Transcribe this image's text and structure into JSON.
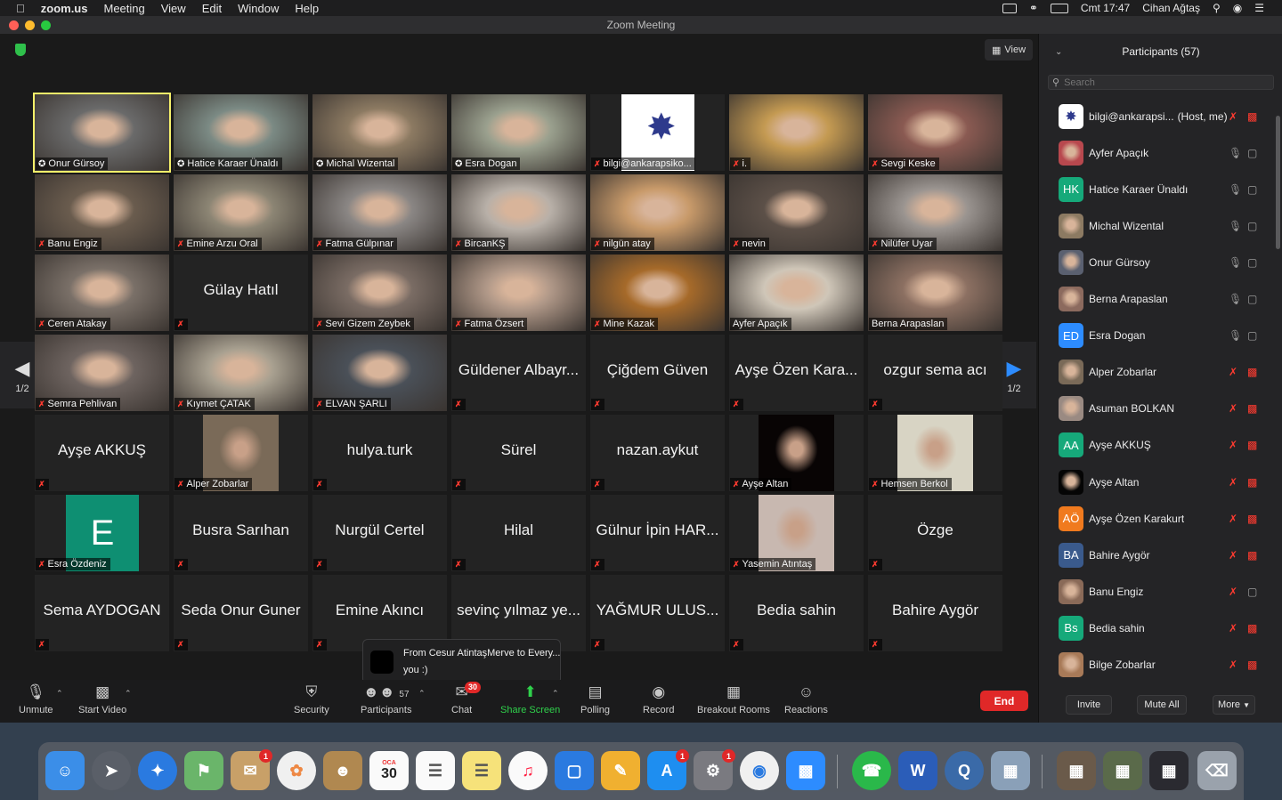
{
  "menubar": {
    "app": "zoom.us",
    "menus": [
      "Meeting",
      "View",
      "Edit",
      "Window",
      "Help"
    ],
    "clock": "Cmt 17:47",
    "user": "Cihan Ağtaş"
  },
  "window": {
    "title": "Zoom Meeting",
    "view_label": "View"
  },
  "pager": {
    "left": "1/2",
    "right": "1/2"
  },
  "tiles": [
    {
      "name": "Onur Gürsoy",
      "type": "video",
      "bg": "#6a6a6a",
      "host": true,
      "active": true
    },
    {
      "name": "Hatice Karaer Ünaldı",
      "type": "video",
      "bg": "#7b8a84",
      "host": true
    },
    {
      "name": "Michal Wizental",
      "type": "video",
      "bg": "#8c7a62",
      "host": true
    },
    {
      "name": "Esra Dogan",
      "type": "video",
      "bg": "#9aa08e",
      "host": true
    },
    {
      "name": "bilgi@ankarapsiko...",
      "type": "logo",
      "bg": "#ffffff",
      "muted": true
    },
    {
      "name": "i.",
      "type": "video",
      "bg": "#c49a52",
      "muted": true
    },
    {
      "name": "Sevgi Keske",
      "type": "video",
      "bg": "#8a5a52",
      "muted": true
    },
    {
      "name": "Banu Engiz",
      "type": "video",
      "bg": "#6a5c4e",
      "muted": true
    },
    {
      "name": "Emine Arzu Oral",
      "type": "video",
      "bg": "#8c8574",
      "muted": true
    },
    {
      "name": "Fatma Gülpınar",
      "type": "video",
      "bg": "#8a8684",
      "muted": true
    },
    {
      "name": "BircanKŞ",
      "type": "video",
      "bg": "#b8b0a8",
      "muted": true
    },
    {
      "name": "nilgün atay",
      "type": "video",
      "bg": "#c89a6a",
      "muted": true
    },
    {
      "name": "nevin",
      "type": "video",
      "bg": "#5c5048",
      "muted": true
    },
    {
      "name": "Nilüfer Uyar",
      "type": "video",
      "bg": "#9a9490",
      "muted": true
    },
    {
      "name": "Ceren Atakay",
      "type": "video",
      "bg": "#7a7068",
      "muted": true
    },
    {
      "name": "Gülay Hatıl",
      "type": "name",
      "muted": true
    },
    {
      "name": "Sevi Gizem Zeybek",
      "type": "video",
      "bg": "#7a6c64",
      "muted": true
    },
    {
      "name": "Fatma Özsert",
      "type": "video",
      "bg": "#b09888",
      "muted": true
    },
    {
      "name": "Mine Kazak",
      "type": "video",
      "bg": "#a66a2a",
      "muted": true
    },
    {
      "name": "Ayfer Apaçık",
      "type": "video",
      "bg": "#cfc6b8"
    },
    {
      "name": "Berna Arapaslan",
      "type": "video",
      "bg": "#8c7062"
    },
    {
      "name": "Semra Pehlivan",
      "type": "video",
      "bg": "#6e6460",
      "muted": true
    },
    {
      "name": "Kıymet ÇATAK",
      "type": "video",
      "bg": "#a8a090",
      "muted": true
    },
    {
      "name": "ELVAN ŞARLI",
      "type": "video",
      "bg": "#4a5058",
      "muted": true
    },
    {
      "name": "Güldener Albayr...",
      "type": "name",
      "muted": true
    },
    {
      "name": "Çiğdem Güven",
      "type": "name",
      "muted": true
    },
    {
      "name": "Ayşe Özen Kara...",
      "type": "name",
      "muted": true
    },
    {
      "name": "ozgur sema acı",
      "type": "name",
      "muted": true
    },
    {
      "name": "Ayşe AKKUŞ",
      "type": "name",
      "muted": true
    },
    {
      "name": "Alper Zobarlar",
      "type": "photo",
      "bg": "#7a6a58",
      "muted": true
    },
    {
      "name": "hulya.turk",
      "type": "name",
      "muted": true
    },
    {
      "name": "Sürel",
      "type": "name",
      "muted": true
    },
    {
      "name": "nazan.aykut",
      "type": "name",
      "muted": true
    },
    {
      "name": "Ayşe Altan",
      "type": "photo",
      "bg": "#080404",
      "muted": true
    },
    {
      "name": "Hemsen Berkol",
      "type": "photo",
      "bg": "#d8d4c4",
      "muted": true
    },
    {
      "name": "Esra Özdeniz",
      "type": "letter",
      "letter": "E",
      "muted": true
    },
    {
      "name": "Busra Sarıhan",
      "type": "name",
      "muted": true
    },
    {
      "name": "Nurgül Certel",
      "type": "name",
      "muted": true
    },
    {
      "name": "Hilal",
      "type": "name",
      "muted": true
    },
    {
      "name": "Gülnur İpin HAR...",
      "type": "name",
      "muted": true
    },
    {
      "name": "Yasemin Atıntaş",
      "type": "photo",
      "bg": "#c8b8b0",
      "muted": true
    },
    {
      "name": "Özge",
      "type": "name",
      "muted": true
    },
    {
      "name": "Sema AYDOGAN",
      "type": "name",
      "muted": true
    },
    {
      "name": "Seda Onur Guner",
      "type": "name",
      "muted": true
    },
    {
      "name": "Emine Akıncı",
      "type": "name",
      "muted": true
    },
    {
      "name": "sevinç yılmaz ye...",
      "type": "name",
      "muted": true
    },
    {
      "name": "YAĞMUR ULUS...",
      "type": "name",
      "muted": true
    },
    {
      "name": "Bedia sahin",
      "type": "name",
      "muted": true
    },
    {
      "name": "Bahire Aygör",
      "type": "name",
      "muted": true
    }
  ],
  "chat_toast": {
    "from": "From Cesur AtintaşMerve to Every...",
    "message": "you :)"
  },
  "toolbar": {
    "unmute": "Unmute",
    "start_video": "Start Video",
    "security": "Security",
    "participants": "Participants",
    "participants_count": "57",
    "chat": "Chat",
    "chat_badge": "30",
    "share": "Share Screen",
    "polling": "Polling",
    "record": "Record",
    "breakout": "Breakout Rooms",
    "reactions": "Reactions",
    "end": "End"
  },
  "panel": {
    "title": "Participants (57)",
    "search_placeholder": "Search",
    "participants": [
      {
        "name": "bilgi@ankarapsi...",
        "suffix": "(Host, me)",
        "av": "logo",
        "color": "#ffffff",
        "mic": "off",
        "cam": "off"
      },
      {
        "name": "Ayfer Apaçık",
        "av": "photo",
        "color": "#b8484e",
        "mic": "on",
        "cam": "on"
      },
      {
        "name": "Hatice Karaer Ünaldı",
        "av": "HK",
        "color": "#16a97a",
        "mic": "on",
        "cam": "on"
      },
      {
        "name": "Michal Wizental",
        "av": "photo",
        "color": "#8c7a62",
        "mic": "on",
        "cam": "on"
      },
      {
        "name": "Onur Gürsoy",
        "av": "photo",
        "color": "#5a6070",
        "mic": "on",
        "cam": "on"
      },
      {
        "name": "Berna Arapaslan",
        "av": "photo",
        "color": "#8c6a5e",
        "mic": "on",
        "cam": "on"
      },
      {
        "name": "Esra Dogan",
        "av": "ED",
        "color": "#2d8cff",
        "mic": "on",
        "cam": "on"
      },
      {
        "name": "Alper Zobarlar",
        "av": "photo",
        "color": "#7a6a58",
        "mic": "off",
        "cam": "off"
      },
      {
        "name": "Asuman BOLKAN",
        "av": "photo",
        "color": "#9a8a82",
        "mic": "off",
        "cam": "off"
      },
      {
        "name": "Ayşe AKKUŞ",
        "av": "AA",
        "color": "#16a97a",
        "mic": "off",
        "cam": "off"
      },
      {
        "name": "Ayşe Altan",
        "av": "photo",
        "color": "#050505",
        "mic": "off",
        "cam": "off"
      },
      {
        "name": "Ayşe Özen Karakurt",
        "av": "AÖ",
        "color": "#f07a1e",
        "mic": "off",
        "cam": "off"
      },
      {
        "name": "Bahire Aygör",
        "av": "BA",
        "color": "#3a5a8c",
        "mic": "off",
        "cam": "off"
      },
      {
        "name": "Banu Engiz",
        "av": "photo",
        "color": "#8a6a58",
        "mic": "off",
        "cam": "on"
      },
      {
        "name": "Bedia sahin",
        "av": "Bs",
        "color": "#16a97a",
        "mic": "off",
        "cam": "off"
      },
      {
        "name": "Bilge Zobarlar",
        "av": "photo",
        "color": "#a87a58",
        "mic": "off",
        "cam": "off"
      }
    ],
    "invite": "Invite",
    "mute_all": "Mute All",
    "more": "More"
  },
  "dock": {
    "calendar_month": "OCA",
    "calendar_day": "30",
    "badges": [
      "1",
      "1",
      "1"
    ]
  }
}
